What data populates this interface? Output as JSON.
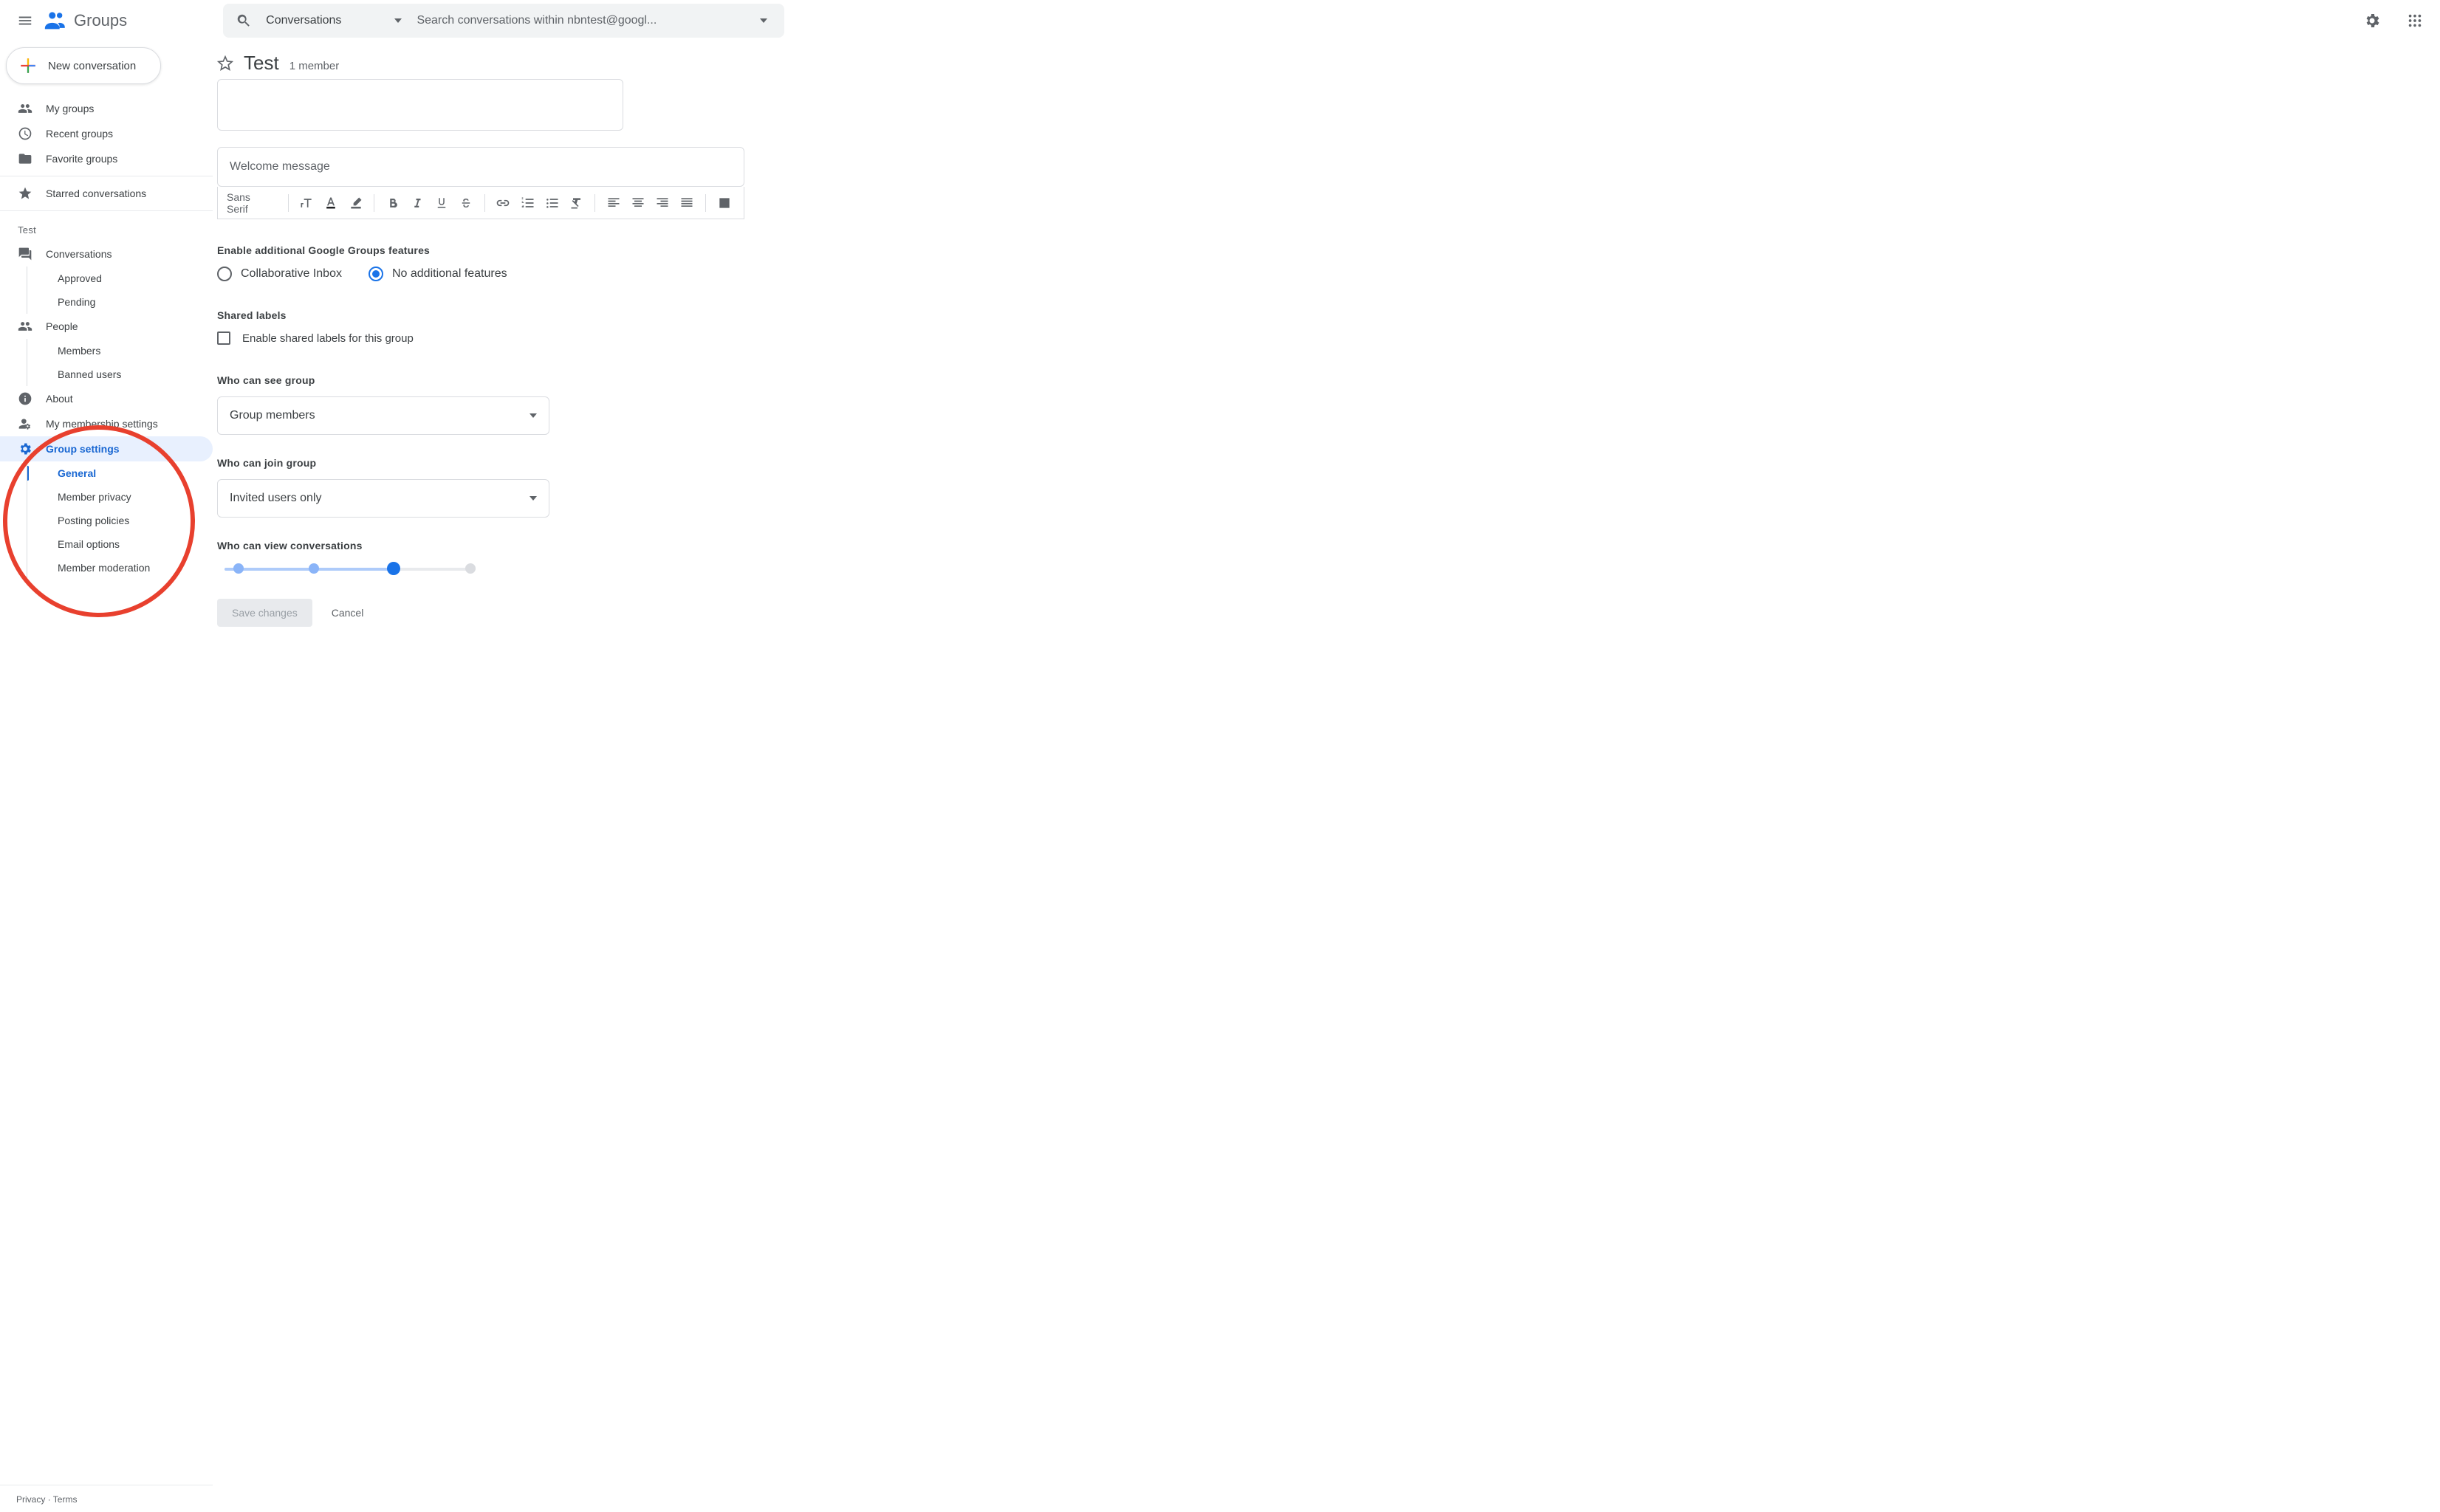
{
  "app": {
    "name": "Groups"
  },
  "search": {
    "scope": "Conversations",
    "placeholder": "Search conversations within nbntest@googl..."
  },
  "compose": {
    "label": "New conversation"
  },
  "sidebar": {
    "items": [
      {
        "icon": "people",
        "label": "My groups"
      },
      {
        "icon": "clock",
        "label": "Recent groups"
      },
      {
        "icon": "folder",
        "label": "Favorite groups"
      },
      {
        "icon": "star",
        "label": "Starred conversations"
      }
    ],
    "group_label": "Test",
    "group_nav": [
      {
        "icon": "forum",
        "label": "Conversations",
        "children": [
          "Approved",
          "Pending"
        ]
      },
      {
        "icon": "people",
        "label": "People",
        "children": [
          "Members",
          "Banned users"
        ]
      },
      {
        "icon": "info",
        "label": "About"
      },
      {
        "icon": "manage",
        "label": "My membership settings"
      },
      {
        "icon": "gear",
        "label": "Group settings",
        "children": [
          "General",
          "Member privacy",
          "Posting policies",
          "Email options",
          "Member moderation"
        ]
      }
    ]
  },
  "footer": {
    "privacy": "Privacy",
    "dot": " · ",
    "terms": "Terms"
  },
  "header": {
    "title": "Test",
    "members": "1 member"
  },
  "editor": {
    "welcome_placeholder": "Welcome message",
    "font": "Sans Serif"
  },
  "features": {
    "label": "Enable additional Google Groups features",
    "opt1": "Collaborative Inbox",
    "opt2": "No additional features"
  },
  "shared_labels": {
    "label": "Shared labels",
    "checkbox": "Enable shared labels for this group"
  },
  "who_see": {
    "label": "Who can see group",
    "value": "Group members"
  },
  "who_join": {
    "label": "Who can join group",
    "value": "Invited users only"
  },
  "who_view": {
    "label": "Who can view conversations"
  },
  "buttons": {
    "save": "Save changes",
    "cancel": "Cancel"
  }
}
